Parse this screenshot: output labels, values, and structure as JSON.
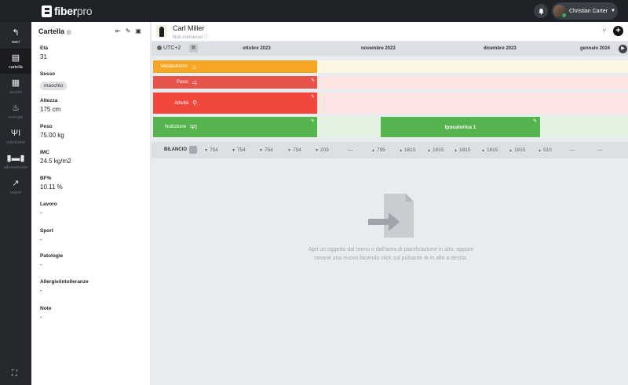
{
  "app": {
    "brand_main": "fiber",
    "brand_sub": "pro",
    "user": "Christian Carter"
  },
  "nav": [
    {
      "icon": "back-arrow-icon",
      "glyph": "↰",
      "label": "esci"
    },
    {
      "icon": "clipboard-icon",
      "glyph": "▤",
      "label": "cartella"
    },
    {
      "icon": "analysis-icon",
      "glyph": "▦",
      "label": "analisi"
    },
    {
      "icon": "flame-icon",
      "glyph": "♨",
      "label": "energia"
    },
    {
      "icon": "fork-knife-icon",
      "glyph": "ΨΙ",
      "label": "nutrizione"
    },
    {
      "icon": "dumbbell-icon",
      "glyph": "▮▬▮",
      "label": "allenamento"
    },
    {
      "icon": "chart-line-icon",
      "glyph": "↗",
      "label": "report"
    }
  ],
  "panel": {
    "title": "Cartella",
    "fields": [
      {
        "label": "Età",
        "value": "31"
      },
      {
        "label": "Sesso",
        "chip": "maschio"
      },
      {
        "label": "Altezza",
        "value": "175 cm"
      },
      {
        "label": "Peso",
        "value": "75.00 kg"
      },
      {
        "label": "IMC",
        "value": "24.5 kg/m2"
      },
      {
        "label": "BF%",
        "value": "10.11 %"
      },
      {
        "label": "Lavoro",
        "value": "-"
      },
      {
        "label": "Sport",
        "value": "-"
      },
      {
        "label": "Patologie",
        "value": "-"
      },
      {
        "label": "Allergie/intolleranze",
        "value": "-"
      },
      {
        "label": "Note",
        "value": "-"
      }
    ]
  },
  "patient": {
    "name": "Carl Miller",
    "status": "Non connesso"
  },
  "timeline": {
    "timezone": "UTC+2",
    "months": [
      "ottobre 2023",
      "novembre 2023",
      "dicembre 2023",
      "gennaio 2024"
    ],
    "rows": [
      {
        "label": "Metabolismo",
        "color": "#f5a623",
        "band": "#fdf6e3"
      },
      {
        "label": "Passi",
        "color": "#e5534b",
        "band": "#fce4e2"
      },
      {
        "label": "Attività",
        "color": "#f1463c",
        "band": "#fce4e2"
      },
      {
        "label": "Nutrizione",
        "color": "#55b44e",
        "band": "#e3f1e1"
      }
    ],
    "plan_block": "Ipocalorica 1"
  },
  "balance": {
    "label": "BILANCIO",
    "values": [
      {
        "dir": "down",
        "v": "754"
      },
      {
        "dir": "down",
        "v": "754"
      },
      {
        "dir": "down",
        "v": "754"
      },
      {
        "dir": "down",
        "v": "754"
      },
      {
        "dir": "down",
        "v": "203"
      },
      {
        "dir": "none",
        "v": "—"
      },
      {
        "dir": "up",
        "v": "795"
      },
      {
        "dir": "up",
        "v": "1815"
      },
      {
        "dir": "up",
        "v": "1815"
      },
      {
        "dir": "up",
        "v": "1815"
      },
      {
        "dir": "up",
        "v": "1815"
      },
      {
        "dir": "up",
        "v": "1815"
      },
      {
        "dir": "up",
        "v": "510"
      },
      {
        "dir": "none",
        "v": "—"
      },
      {
        "dir": "none",
        "v": "—"
      }
    ]
  },
  "empty_state": {
    "line1": "Apri un oggetto dal menu o dall'area di pianificazione in alto, oppure",
    "line2": "creane uno nuovo facendo click sul pulsante ⊕ in alto a destra."
  }
}
